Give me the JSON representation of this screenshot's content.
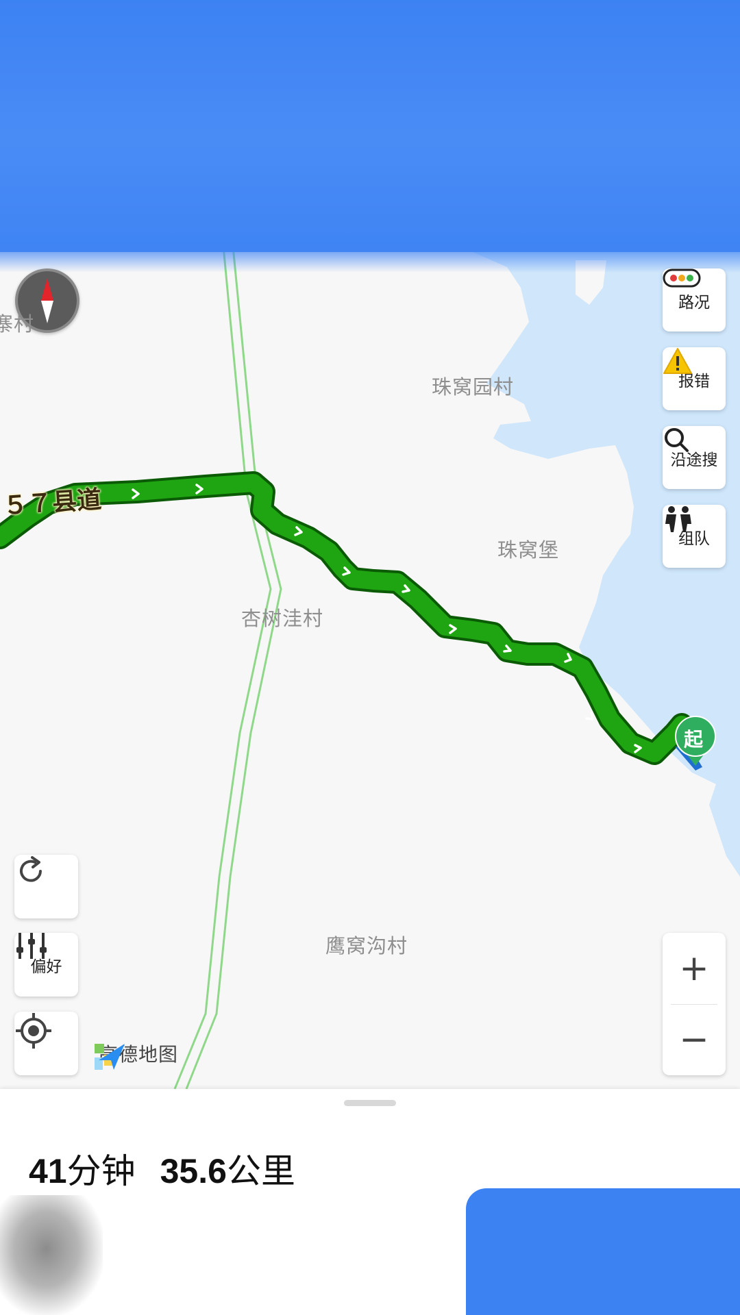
{
  "map": {
    "road_label": "５７县道",
    "places": {
      "zhuwoyuan": "珠窝园村",
      "zhuwobao": "珠窝堡",
      "xingshuwa": "杏树洼村",
      "yingwogou": "鹰窝沟村",
      "edge_village": "寨村"
    },
    "start_marker": "起",
    "logo_text": "高德地图",
    "colors": {
      "route": "#1fa512",
      "water": "#cfe6fb",
      "rail": "#8fd88a",
      "start_marker": "#2fae5f",
      "redaction": "#3d82f3"
    }
  },
  "controls": {
    "traffic": {
      "label": "路况",
      "icon": "traffic-light-icon"
    },
    "report": {
      "label": "报错",
      "icon": "warning-icon"
    },
    "search_along": {
      "label": "沿途搜",
      "icon": "search-icon"
    },
    "team": {
      "label": "组队",
      "icon": "team-icon"
    },
    "refresh": {
      "icon": "refresh-icon"
    },
    "preference": {
      "label": "偏好",
      "icon": "sliders-icon"
    },
    "locate": {
      "icon": "locate-icon"
    },
    "zoom_in": "+",
    "zoom_out": "−"
  },
  "route_summary": {
    "duration_value": "41",
    "duration_unit": "分钟",
    "distance_value": "35.6",
    "distance_unit": "公里"
  }
}
